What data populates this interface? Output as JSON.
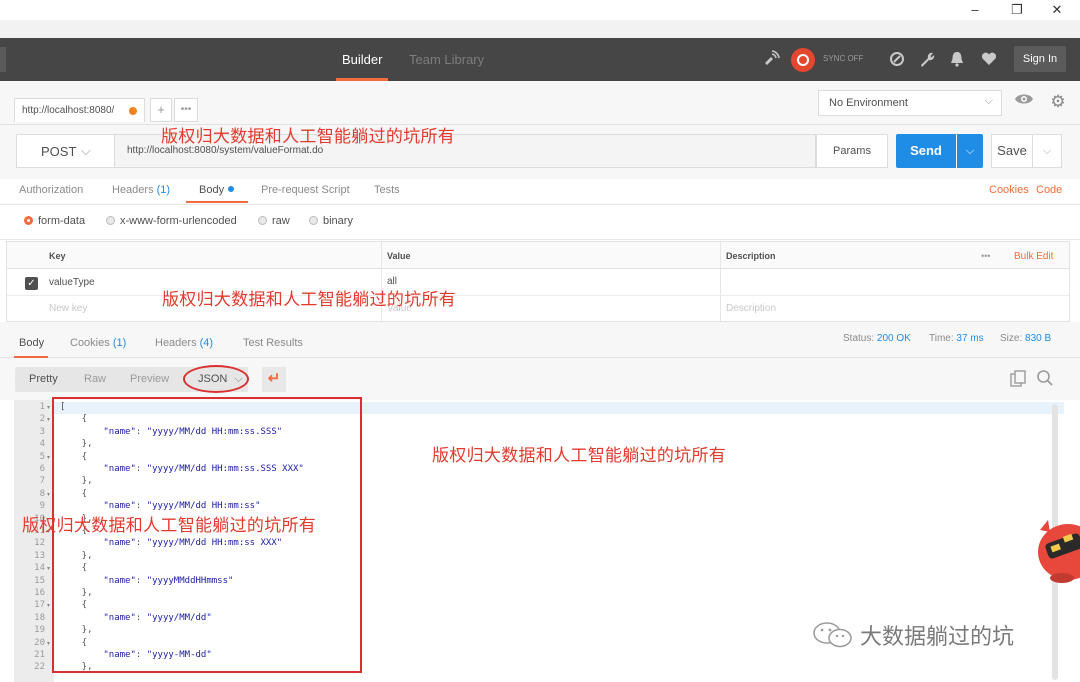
{
  "window": {
    "minimize": "–",
    "restore": "❐",
    "close": "✕"
  },
  "header": {
    "tabs": [
      {
        "label": "Builder",
        "active": true
      },
      {
        "label": "Team Library",
        "active": false
      }
    ],
    "sync_label": "SYNC OFF",
    "sign_in": "Sign In",
    "icons": [
      "satellite-icon",
      "sync-icon",
      "interceptor-icon",
      "wrench-icon",
      "bell-icon",
      "heart-icon"
    ]
  },
  "request_tab": {
    "label": "http://localhost:8080/",
    "has_changes": true,
    "add": "+",
    "more": "•••"
  },
  "environment": {
    "selected": "No Environment"
  },
  "request": {
    "method": "POST",
    "url": "http://localhost:8080/system/valueFormat.do",
    "params": "Params",
    "send": "Send",
    "save": "Save"
  },
  "subtabs": {
    "authorization": "Authorization",
    "headers": "Headers",
    "headers_count": "(1)",
    "body": "Body",
    "prerequest": "Pre-request Script",
    "tests": "Tests",
    "cookies": "Cookies",
    "code": "Code"
  },
  "body_modes": [
    {
      "label": "form-data",
      "selected": true
    },
    {
      "label": "x-www-form-urlencoded",
      "selected": false
    },
    {
      "label": "raw",
      "selected": false
    },
    {
      "label": "binary",
      "selected": false
    }
  ],
  "kv_table": {
    "headers": {
      "key": "Key",
      "value": "Value",
      "description": "Description",
      "more": "•••",
      "bulk_edit": "Bulk Edit"
    },
    "rows": [
      {
        "checked": true,
        "key": "valueType",
        "value": "all",
        "description": ""
      }
    ],
    "placeholders": {
      "key": "New key",
      "value": "Value",
      "description": "Description"
    }
  },
  "response": {
    "tabs": {
      "body": "Body",
      "cookies": "Cookies",
      "cookies_count": "(1)",
      "headers": "Headers",
      "headers_count": "(4)",
      "tests": "Test Results"
    },
    "status_label": "Status:",
    "status": "200 OK",
    "time_label": "Time:",
    "time": "37 ms",
    "size_label": "Size:",
    "size": "830 B",
    "views": [
      "Pretty",
      "Raw",
      "Preview"
    ],
    "active_view": "Pretty",
    "format": "JSON"
  },
  "code_lines": [
    {
      "n": "1",
      "fold": true,
      "text": "["
    },
    {
      "n": "2",
      "fold": true,
      "text": "    {"
    },
    {
      "n": "3",
      "fold": false,
      "key": "\"name\"",
      "val": "\"yyyy/MM/dd HH:mm:ss.SSS\""
    },
    {
      "n": "4",
      "fold": false,
      "text": "    },"
    },
    {
      "n": "5",
      "fold": true,
      "text": "    {"
    },
    {
      "n": "6",
      "fold": false,
      "key": "\"name\"",
      "val": "\"yyyy/MM/dd HH:mm:ss.SSS XXX\""
    },
    {
      "n": "7",
      "fold": false,
      "text": "    },"
    },
    {
      "n": "8",
      "fold": true,
      "text": "    {"
    },
    {
      "n": "9",
      "fold": false,
      "key": "\"name\"",
      "val": "\"yyyy/MM/dd HH:mm:ss\""
    },
    {
      "n": "10",
      "fold": false,
      "text": "    },"
    },
    {
      "n": "11",
      "fold": true,
      "text": "    {"
    },
    {
      "n": "12",
      "fold": false,
      "key": "\"name\"",
      "val": "\"yyyy/MM/dd HH:mm:ss XXX\""
    },
    {
      "n": "13",
      "fold": false,
      "text": "    },"
    },
    {
      "n": "14",
      "fold": true,
      "text": "    {"
    },
    {
      "n": "15",
      "fold": false,
      "key": "\"name\"",
      "val": "\"yyyyMMddHHmmss\""
    },
    {
      "n": "16",
      "fold": false,
      "text": "    },"
    },
    {
      "n": "17",
      "fold": true,
      "text": "    {"
    },
    {
      "n": "18",
      "fold": false,
      "key": "\"name\"",
      "val": "\"yyyy/MM/dd\""
    },
    {
      "n": "19",
      "fold": false,
      "text": "    },"
    },
    {
      "n": "20",
      "fold": true,
      "text": "    {"
    },
    {
      "n": "21",
      "fold": false,
      "key": "\"name\"",
      "val": "\"yyyy-MM-dd\""
    },
    {
      "n": "22",
      "fold": false,
      "text": "    },"
    }
  ],
  "watermark": "版权归大数据和人工智能躺过的坑所有",
  "brand": "大数据躺过的坑",
  "colors": {
    "accent": "#f26b3a",
    "send": "#1f8ce6",
    "header": "#464646",
    "annotation": "#d9302f"
  }
}
